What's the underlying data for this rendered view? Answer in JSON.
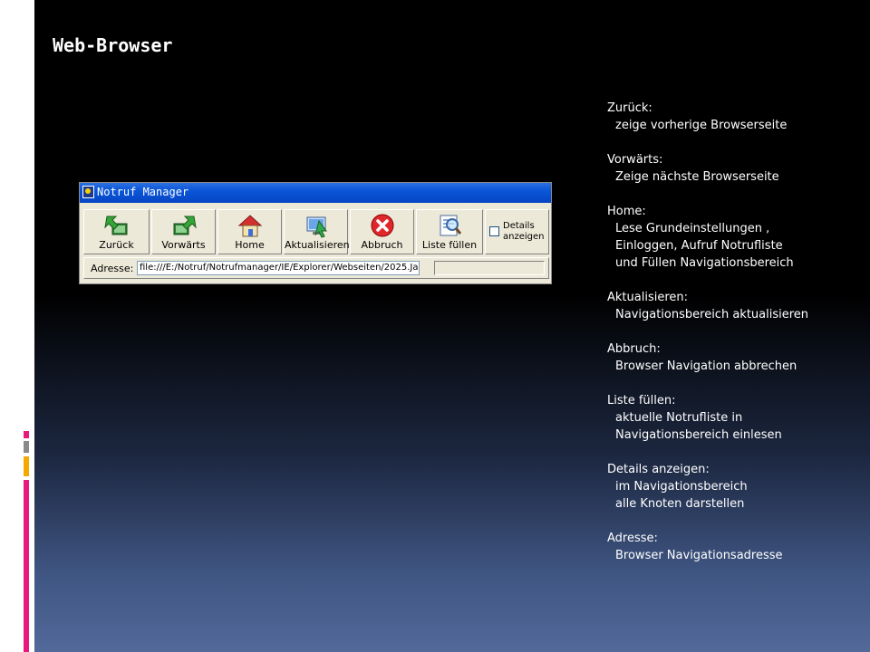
{
  "slide": {
    "title": "Web-Browser"
  },
  "window": {
    "title": "Notruf Manager",
    "buttons": [
      {
        "label": "Zurück",
        "icon": "back-arrow-icon"
      },
      {
        "label": "Vorwärts",
        "icon": "forward-arrow-icon"
      },
      {
        "label": "Home",
        "icon": "home-icon"
      },
      {
        "label": "Aktualisieren",
        "icon": "refresh-icon"
      },
      {
        "label": "Abbruch",
        "icon": "stop-icon"
      },
      {
        "label": "Liste füllen",
        "icon": "list-search-icon"
      }
    ],
    "details_checkbox": {
      "label": "Details anzeigen",
      "checked": false
    },
    "address": {
      "label": "Adresse:",
      "value": "file:///E:/Notruf/Notrufmanager/IE/Explorer/Webseiten/2025.Ja"
    }
  },
  "descriptions": [
    {
      "head": "Zurück:",
      "lines": [
        "zeige vorherige Browserseite"
      ]
    },
    {
      "head": "Vorwärts:",
      "lines": [
        "Zeige nächste Browserseite"
      ]
    },
    {
      "head": "Home:",
      "lines": [
        "Lese Grundeinstellungen ,",
        "Einloggen, Aufruf Notrufliste",
        "und Füllen Navigationsbereich"
      ]
    },
    {
      "head": "Aktualisieren:",
      "lines": [
        "Navigationsbereich aktualisieren"
      ]
    },
    {
      "head": "Abbruch:",
      "lines": [
        "Browser Navigation abbrechen"
      ]
    },
    {
      "head": "Liste füllen:",
      "lines": [
        "aktuelle Notrufliste in",
        "Navigationsbereich einlesen"
      ]
    },
    {
      "head": "Details anzeigen:",
      "lines": [
        "im Navigationsbereich",
        "alle Knoten darstellen"
      ]
    },
    {
      "head": "Adresse:",
      "lines": [
        "Browser Navigationsadresse"
      ]
    }
  ],
  "colors": {
    "accent_pink": "#e8197a",
    "accent_orange": "#f5a800",
    "titlebar_blue": "#0a55d8"
  }
}
